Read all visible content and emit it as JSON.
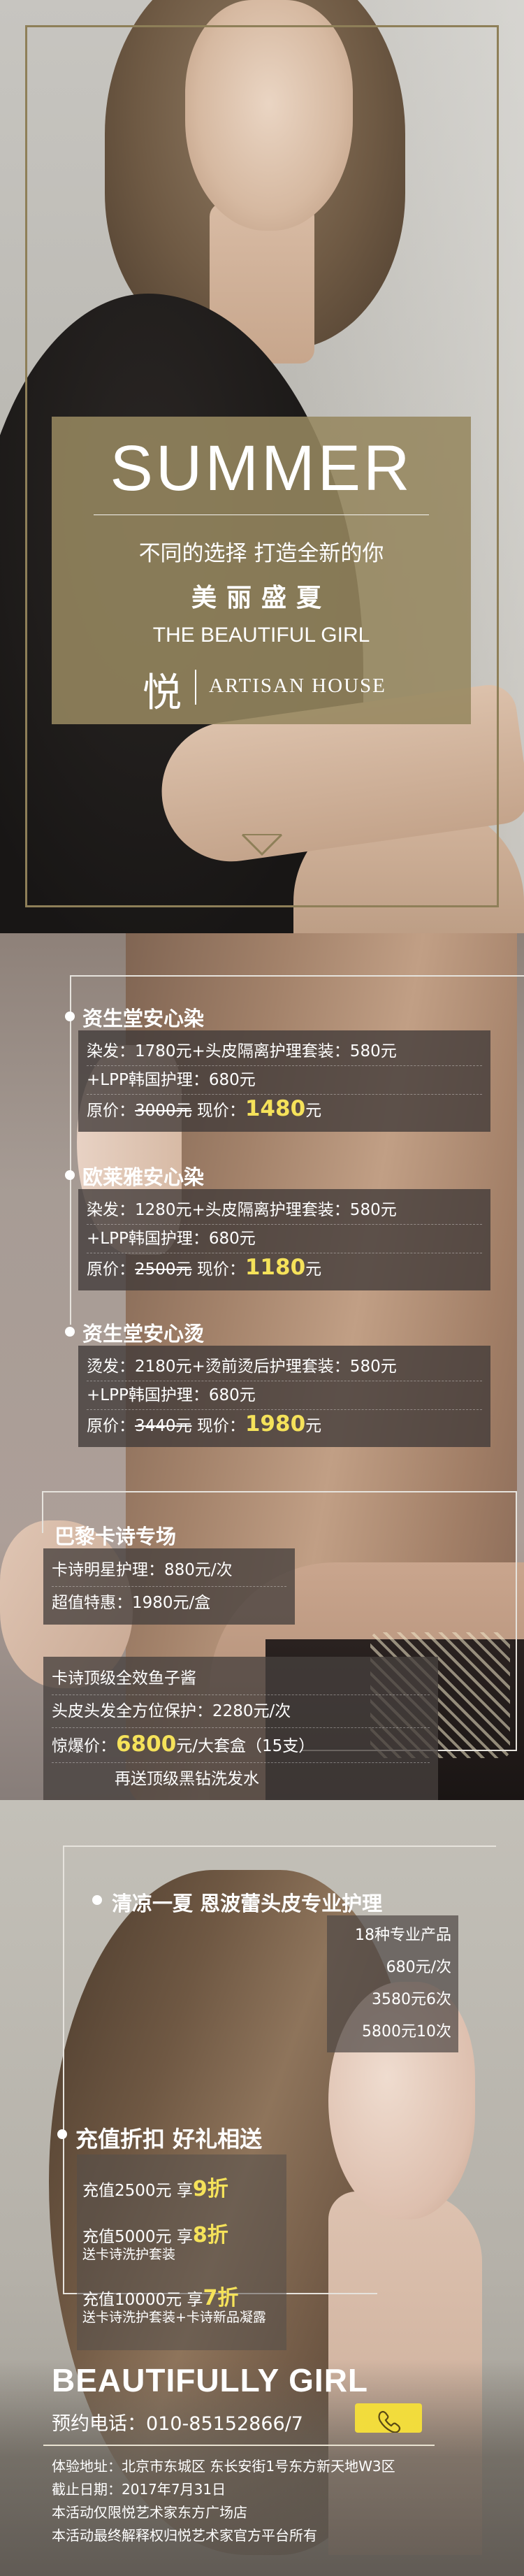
{
  "hero": {
    "title": "SUMMER",
    "line1": "不同的选择 打造全新的你",
    "line2": "美丽盛夏",
    "line3": "THE BEAUTIFUL GIRL",
    "brand_glyph": "悦",
    "brand_text": "ARTISAN HOUSE"
  },
  "items": [
    {
      "title": "资生堂安心染",
      "line1": "染发：1780元+头皮隔离护理套装：580元",
      "line2": "+LPP韩国护理：680元",
      "orig_label": "原价：",
      "orig_price": "3000元",
      "now_label": "现价：",
      "now_price": "1480",
      "unit": "元"
    },
    {
      "title": "欧莱雅安心染",
      "line1": "染发：1280元+头皮隔离护理套装：580元",
      "line2": "+LPP韩国护理：680元",
      "orig_label": "原价：",
      "orig_price": "2500元",
      "now_label": "现价：",
      "now_price": "1180",
      "unit": "元"
    },
    {
      "title": "资生堂安心烫",
      "line1": "烫发：2180元+烫前烫后护理套装：580元",
      "line2": "+LPP韩国护理：680元",
      "orig_label": "原价：",
      "orig_price": "3440元",
      "now_label": "现价：",
      "now_price": "1980",
      "unit": "元"
    }
  ],
  "kashi": {
    "title": "巴黎卡诗专场",
    "line1": "卡诗明星护理：880元/次",
    "line2": "超值特惠：1980元/盒",
    "line3": "卡诗顶级全效鱼子酱",
    "line4": "头皮头发全方位保护：2280元/次",
    "line5_label": "惊爆价：",
    "line5_price": "6800",
    "line5_rest": "元/大套盒（15支）",
    "line6": "再送顶级黑钻洗发水"
  },
  "scalp": {
    "title": "清凉一夏 恩波蕾头皮专业护理",
    "lines": [
      "18种专业产品",
      "680元/次",
      "3580元6次",
      "5800元10次"
    ]
  },
  "recharge": {
    "title": "充值折扣 好礼相送",
    "t1_label": "充值2500元  享",
    "t1_discount": "9折",
    "t2_label": "充值5000元  享",
    "t2_discount": "8折",
    "t2_note": "送卡诗洗护套装",
    "t3_label": "充值10000元  享",
    "t3_discount": "7折",
    "t3_note": "送卡诗洗护套装+卡诗新品凝露"
  },
  "footer": {
    "title": "BEAUTIFULLY GIRL",
    "phone": "预约电话：010-85152866/7",
    "address": "体验地址：北京市东城区  东长安街1号东方新天地W3区",
    "deadline": "截止日期：2017年7月31日",
    "note1": "本活动仅限悦艺术家东方广场店",
    "note2": "本活动最终解释权归悦艺术家官方平台所有"
  },
  "colors": {
    "panel": "#968860",
    "frame": "#8e7f58",
    "accent_yellow": "#f5e25a",
    "phone_button": "#f2dc3c"
  },
  "icons": [
    "chevron-down-icon",
    "phone-icon"
  ]
}
